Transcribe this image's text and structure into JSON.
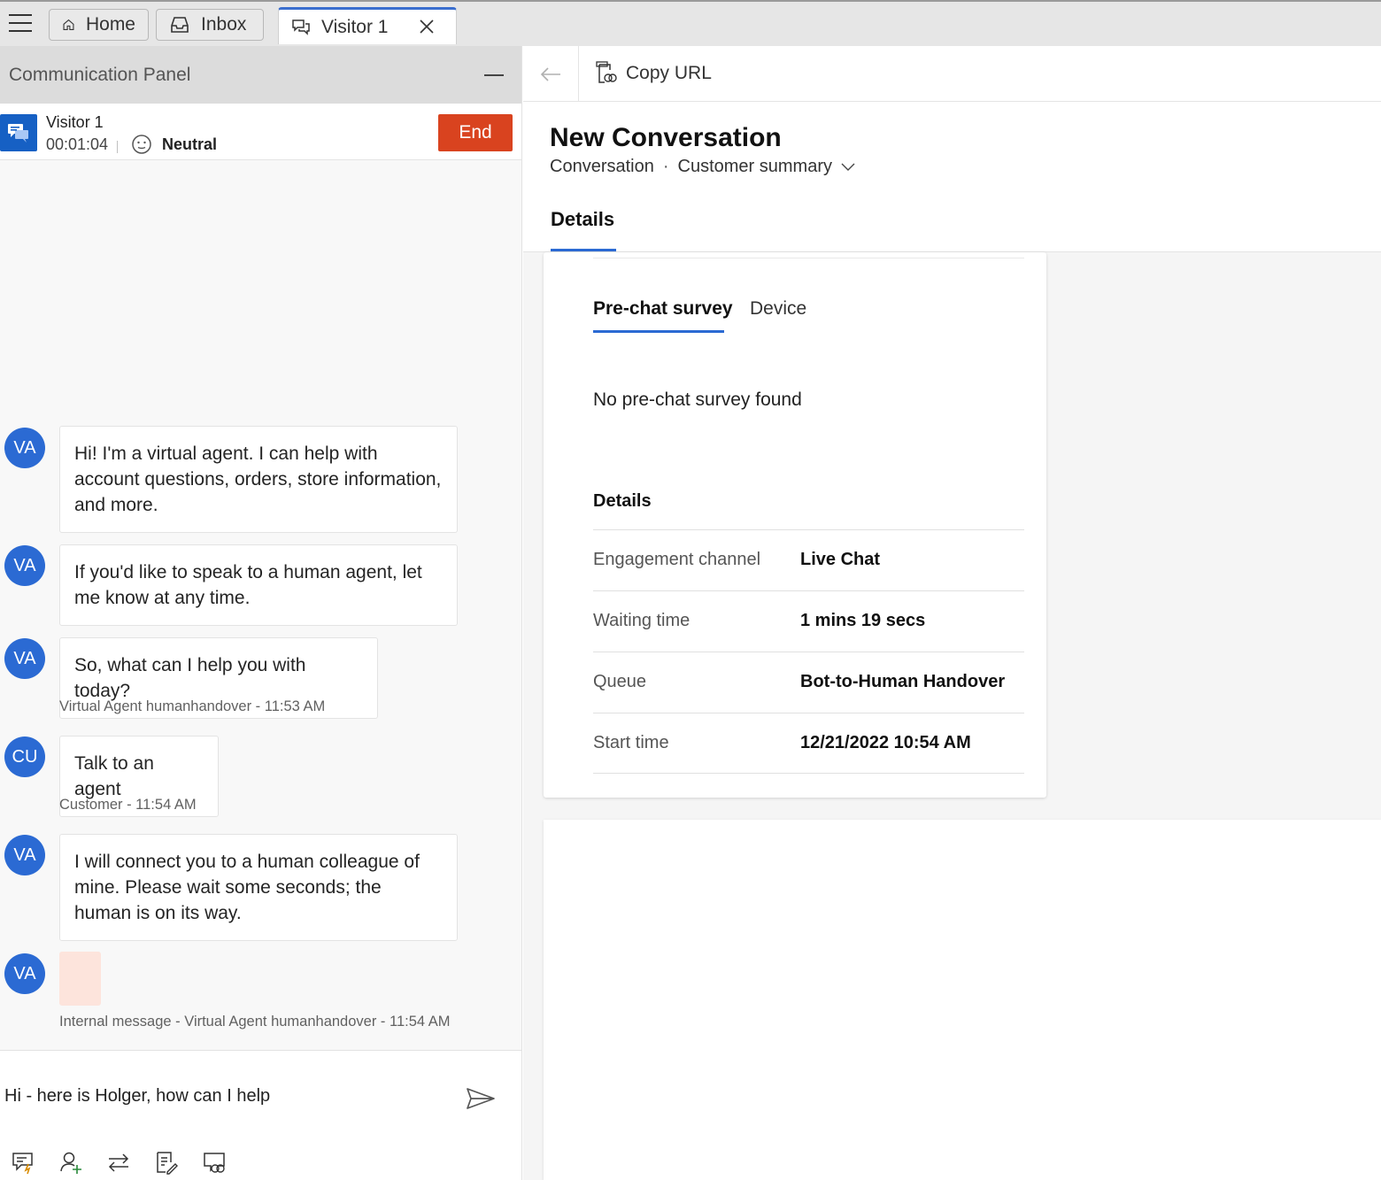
{
  "tabs": [
    {
      "label": "Home",
      "icon": "home-icon"
    },
    {
      "label": "Inbox",
      "icon": "inbox-icon"
    },
    {
      "label": "Visitor 1",
      "icon": "chat-icon",
      "active": true
    }
  ],
  "comm_panel": {
    "title": "Communication Panel",
    "visitor_name": "Visitor 1",
    "timer": "00:01:04",
    "sentiment": "Neutral",
    "end_label": "End"
  },
  "messages": [
    {
      "avatar": "VA",
      "text": "Hi! I'm a virtual agent. I can help with account questions, orders, store information, and more."
    },
    {
      "avatar": "VA",
      "text": "If you'd like to speak to a human agent, let me know at any time."
    },
    {
      "avatar": "VA",
      "text": "So, what can I help you with today?",
      "meta": "Virtual Agent humanhandover - 11:53 AM"
    },
    {
      "avatar": "CU",
      "text": "Talk to an agent",
      "meta": "Customer - 11:54 AM"
    },
    {
      "avatar": "VA",
      "text": "I will connect you to a human colleague of mine. Please wait some seconds; the human is on its way."
    },
    {
      "avatar": "VA",
      "text": "",
      "meta": "Internal message - Virtual Agent humanhandover - 11:54 AM"
    }
  ],
  "compose": {
    "text": "Hi - here is Holger, how can I help"
  },
  "commandbar": {
    "copy_url": "Copy URL"
  },
  "record": {
    "title": "New Conversation",
    "entity": "Conversation",
    "form": "Customer summary",
    "tab": "Details"
  },
  "survey_card": {
    "tabs": [
      "Pre-chat survey",
      "Device"
    ],
    "empty": "No pre-chat survey found",
    "section": "Details",
    "rows": [
      {
        "label": "Engagement channel",
        "value": "Live Chat"
      },
      {
        "label": "Waiting time",
        "value": "1 mins 19 secs"
      },
      {
        "label": "Queue",
        "value": "Bot-to-Human Handover"
      },
      {
        "label": "Start time",
        "value": "12/21/2022 10:54 AM"
      }
    ]
  },
  "colors": {
    "accent": "#2b6ad3",
    "end_button": "#d9431f",
    "internal_bubble": "#fde4dc"
  }
}
